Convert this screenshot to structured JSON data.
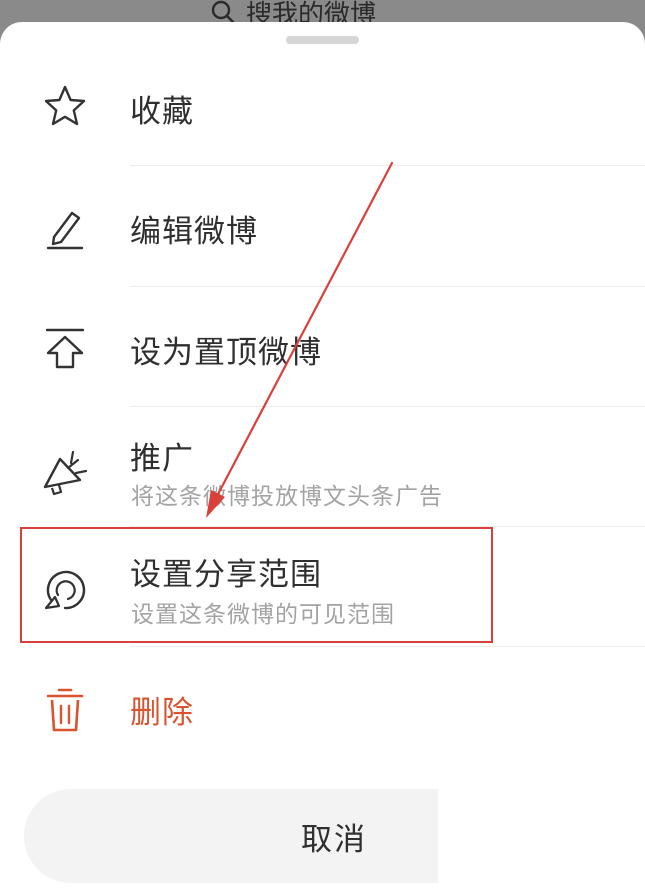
{
  "search": {
    "text": "搜我的微博",
    "icon": "search-icon"
  },
  "menu": {
    "items": [
      {
        "label": "收藏",
        "icon": "star-icon"
      },
      {
        "label": "编辑微博",
        "icon": "pencil-icon"
      },
      {
        "label": "设为置顶微博",
        "icon": "pin-top-icon"
      },
      {
        "label": "推广",
        "sublabel": "将这条微博投放博文头条广告",
        "icon": "megaphone-icon"
      },
      {
        "label": "设置分享范围",
        "sublabel": "设置这条微博的可见范围",
        "icon": "share-scope-icon"
      },
      {
        "label": "删除",
        "icon": "trash-icon"
      }
    ]
  },
  "cancel": {
    "label": "取消"
  },
  "colors": {
    "delete": "#d9532f",
    "annotation": "#d9403a",
    "text": "#2f2f2f",
    "subtext": "#a3a3a3"
  }
}
